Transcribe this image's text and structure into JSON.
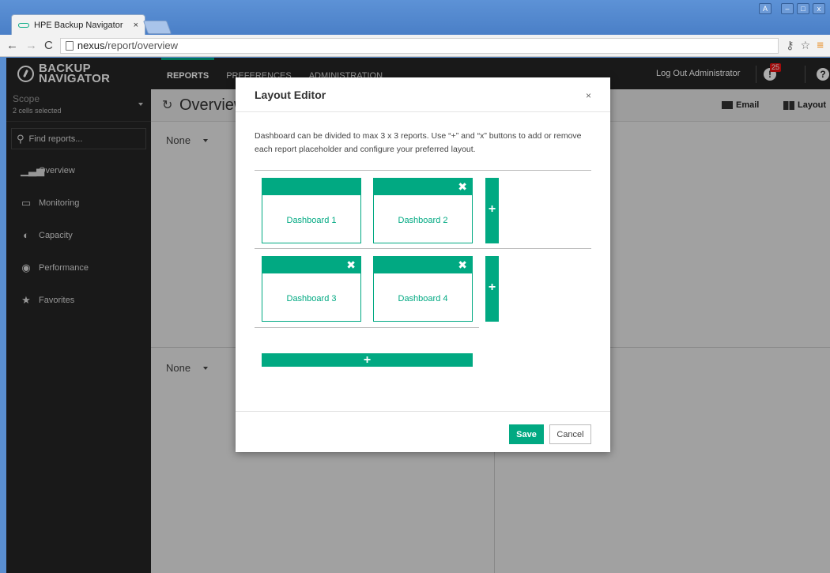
{
  "browser": {
    "tab_title": "HPE Backup Navigator",
    "tab_close": "×",
    "url_host": "nexus",
    "url_path": "/report/overview",
    "window_controls": [
      "A",
      "–",
      "□",
      "x"
    ]
  },
  "app": {
    "logo_line1": "BACKUP",
    "logo_line2": "NAVIGATOR",
    "nav": [
      "REPORTS",
      "PREFERENCES",
      "ADMINISTRATION"
    ],
    "logout": "Log Out Administrator",
    "alert_count": "25",
    "accent": "#01a982"
  },
  "sidebar": {
    "scope_label": "Scope",
    "scope_sub": "2 cells selected",
    "find_placeholder": "Find reports...",
    "items": [
      "Overview",
      "Monitoring",
      "Capacity",
      "Performance",
      "Favorites"
    ]
  },
  "main": {
    "title": "Overview",
    "email": "Email",
    "layout": "Layout",
    "panel_select": "None"
  },
  "modal": {
    "title": "Layout Editor",
    "close": "×",
    "description": "Dashboard can be divided to max 3 x 3 reports. Use “+” and “x” buttons to add or remove each report placeholder and configure your preferred layout.",
    "dashboards": [
      "Dashboard 1",
      "Dashboard 2",
      "Dashboard 3",
      "Dashboard 4"
    ],
    "save": "Save",
    "cancel": "Cancel"
  }
}
